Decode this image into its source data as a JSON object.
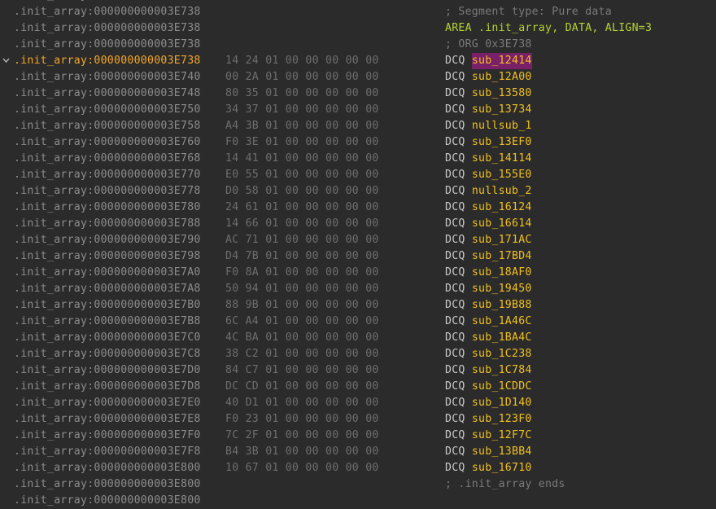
{
  "view": {
    "segment_prefix": ".init_array:",
    "highlight_color": "#7a2068",
    "rows": [
      {
        "addr": "000000000003E738",
        "hex": "",
        "kind": "blank",
        "text": ""
      },
      {
        "addr": "000000000003E738",
        "hex": "",
        "kind": "comment",
        "text": "; Segment type: Pure data"
      },
      {
        "addr": "000000000003E738",
        "hex": "",
        "kind": "directive",
        "text": "AREA .init_array, DATA, ALIGN=3"
      },
      {
        "addr": "000000000003E738",
        "hex": "",
        "kind": "comment",
        "text": "; ORG 0x3E738"
      },
      {
        "addr": "000000000003E738",
        "hex": "14 24 01 00 00 00 00 00",
        "kind": "dcq",
        "mnemonic": "DCQ",
        "operand": "sub_12414",
        "current": true,
        "highlight": true,
        "gutter": "chevron-down-icon"
      },
      {
        "addr": "000000000003E740",
        "hex": "00 2A 01 00 00 00 00 00",
        "kind": "dcq",
        "mnemonic": "DCQ",
        "operand": "sub_12A00"
      },
      {
        "addr": "000000000003E748",
        "hex": "80 35 01 00 00 00 00 00",
        "kind": "dcq",
        "mnemonic": "DCQ",
        "operand": "sub_13580"
      },
      {
        "addr": "000000000003E750",
        "hex": "34 37 01 00 00 00 00 00",
        "kind": "dcq",
        "mnemonic": "DCQ",
        "operand": "sub_13734"
      },
      {
        "addr": "000000000003E758",
        "hex": "A4 3B 01 00 00 00 00 00",
        "kind": "dcq",
        "mnemonic": "DCQ",
        "operand": "nullsub_1"
      },
      {
        "addr": "000000000003E760",
        "hex": "F0 3E 01 00 00 00 00 00",
        "kind": "dcq",
        "mnemonic": "DCQ",
        "operand": "sub_13EF0"
      },
      {
        "addr": "000000000003E768",
        "hex": "14 41 01 00 00 00 00 00",
        "kind": "dcq",
        "mnemonic": "DCQ",
        "operand": "sub_14114"
      },
      {
        "addr": "000000000003E770",
        "hex": "E0 55 01 00 00 00 00 00",
        "kind": "dcq",
        "mnemonic": "DCQ",
        "operand": "sub_155E0"
      },
      {
        "addr": "000000000003E778",
        "hex": "D0 58 01 00 00 00 00 00",
        "kind": "dcq",
        "mnemonic": "DCQ",
        "operand": "nullsub_2"
      },
      {
        "addr": "000000000003E780",
        "hex": "24 61 01 00 00 00 00 00",
        "kind": "dcq",
        "mnemonic": "DCQ",
        "operand": "sub_16124"
      },
      {
        "addr": "000000000003E788",
        "hex": "14 66 01 00 00 00 00 00",
        "kind": "dcq",
        "mnemonic": "DCQ",
        "operand": "sub_16614"
      },
      {
        "addr": "000000000003E790",
        "hex": "AC 71 01 00 00 00 00 00",
        "kind": "dcq",
        "mnemonic": "DCQ",
        "operand": "sub_171AC"
      },
      {
        "addr": "000000000003E798",
        "hex": "D4 7B 01 00 00 00 00 00",
        "kind": "dcq",
        "mnemonic": "DCQ",
        "operand": "sub_17BD4"
      },
      {
        "addr": "000000000003E7A0",
        "hex": "F0 8A 01 00 00 00 00 00",
        "kind": "dcq",
        "mnemonic": "DCQ",
        "operand": "sub_18AF0"
      },
      {
        "addr": "000000000003E7A8",
        "hex": "50 94 01 00 00 00 00 00",
        "kind": "dcq",
        "mnemonic": "DCQ",
        "operand": "sub_19450"
      },
      {
        "addr": "000000000003E7B0",
        "hex": "88 9B 01 00 00 00 00 00",
        "kind": "dcq",
        "mnemonic": "DCQ",
        "operand": "sub_19B88"
      },
      {
        "addr": "000000000003E7B8",
        "hex": "6C A4 01 00 00 00 00 00",
        "kind": "dcq",
        "mnemonic": "DCQ",
        "operand": "sub_1A46C"
      },
      {
        "addr": "000000000003E7C0",
        "hex": "4C BA 01 00 00 00 00 00",
        "kind": "dcq",
        "mnemonic": "DCQ",
        "operand": "sub_1BA4C"
      },
      {
        "addr": "000000000003E7C8",
        "hex": "38 C2 01 00 00 00 00 00",
        "kind": "dcq",
        "mnemonic": "DCQ",
        "operand": "sub_1C238"
      },
      {
        "addr": "000000000003E7D0",
        "hex": "84 C7 01 00 00 00 00 00",
        "kind": "dcq",
        "mnemonic": "DCQ",
        "operand": "sub_1C784"
      },
      {
        "addr": "000000000003E7D8",
        "hex": "DC CD 01 00 00 00 00 00",
        "kind": "dcq",
        "mnemonic": "DCQ",
        "operand": "sub_1CDDC"
      },
      {
        "addr": "000000000003E7E0",
        "hex": "40 D1 01 00 00 00 00 00",
        "kind": "dcq",
        "mnemonic": "DCQ",
        "operand": "sub_1D140"
      },
      {
        "addr": "000000000003E7E8",
        "hex": "F0 23 01 00 00 00 00 00",
        "kind": "dcq",
        "mnemonic": "DCQ",
        "operand": "sub_123F0"
      },
      {
        "addr": "000000000003E7F0",
        "hex": "7C 2F 01 00 00 00 00 00",
        "kind": "dcq",
        "mnemonic": "DCQ",
        "operand": "sub_12F7C"
      },
      {
        "addr": "000000000003E7F8",
        "hex": "B4 3B 01 00 00 00 00 00",
        "kind": "dcq",
        "mnemonic": "DCQ",
        "operand": "sub_13BB4"
      },
      {
        "addr": "000000000003E800",
        "hex": "10 67 01 00 00 00 00 00",
        "kind": "dcq",
        "mnemonic": "DCQ",
        "operand": "sub_16710"
      },
      {
        "addr": "000000000003E800",
        "hex": "",
        "kind": "comment",
        "text": "; .init_array ends"
      },
      {
        "addr": "000000000003E800",
        "hex": "",
        "kind": "blank",
        "text": ""
      }
    ]
  }
}
